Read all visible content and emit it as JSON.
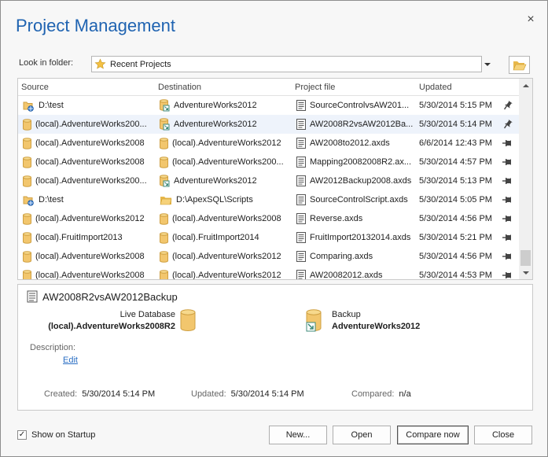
{
  "dialog": {
    "title": "Project Management",
    "close_glyph": "×"
  },
  "folder": {
    "label": "Look in folder:",
    "selected": "Recent Projects",
    "icon": "star-icon",
    "browse_icon": "open-folder-icon"
  },
  "list": {
    "columns": {
      "source": "Source",
      "destination": "Destination",
      "project_file": "Project file",
      "updated": "Updated"
    },
    "rows": [
      {
        "source": "D:\\test",
        "src_icon": "script-folder-icon",
        "destination": "AdventureWorks2012",
        "dst_icon": "backup-icon",
        "file": "SourceControlvsAW201...",
        "updated": "5/30/2014 5:15 PM",
        "pinned": true,
        "selected": false
      },
      {
        "source": "(local).AdventureWorks200...",
        "src_icon": "database-icon",
        "destination": "AdventureWorks2012",
        "dst_icon": "backup-icon",
        "file": "AW2008R2vsAW2012Ba...",
        "updated": "5/30/2014 5:14 PM",
        "pinned": true,
        "selected": true
      },
      {
        "source": "(local).AdventureWorks2008",
        "src_icon": "database-icon",
        "destination": "(local).AdventureWorks2012",
        "dst_icon": "database-icon",
        "file": "AW2008to2012.axds",
        "updated": "6/6/2014 12:43 PM",
        "pinned": false,
        "selected": false
      },
      {
        "source": "(local).AdventureWorks2008",
        "src_icon": "database-icon",
        "destination": "(local).AdventureWorks200...",
        "dst_icon": "database-icon",
        "file": "Mapping20082008R2.ax...",
        "updated": "5/30/2014 4:57 PM",
        "pinned": false,
        "selected": false
      },
      {
        "source": "(local).AdventureWorks200...",
        "src_icon": "database-icon",
        "destination": "AdventureWorks2012",
        "dst_icon": "backup-icon",
        "file": "AW2012Backup2008.axds",
        "updated": "5/30/2014 5:13 PM",
        "pinned": false,
        "selected": false
      },
      {
        "source": "D:\\test",
        "src_icon": "script-folder-icon",
        "destination": "D:\\ApexSQL\\Scripts",
        "dst_icon": "folder-icon",
        "file": "SourceControlScript.axds",
        "updated": "5/30/2014 5:05 PM",
        "pinned": false,
        "selected": false
      },
      {
        "source": "(local).AdventureWorks2012",
        "src_icon": "database-icon",
        "destination": "(local).AdventureWorks2008",
        "dst_icon": "database-icon",
        "file": "Reverse.axds",
        "updated": "5/30/2014 4:56 PM",
        "pinned": false,
        "selected": false
      },
      {
        "source": "(local).FruitImport2013",
        "src_icon": "database-icon",
        "destination": "(local).FruitImport2014",
        "dst_icon": "database-icon",
        "file": "FruitImport20132014.axds",
        "updated": "5/30/2014 5:21 PM",
        "pinned": false,
        "selected": false
      },
      {
        "source": "(local).AdventureWorks2008",
        "src_icon": "database-icon",
        "destination": "(local).AdventureWorks2012",
        "dst_icon": "database-icon",
        "file": "Comparing.axds",
        "updated": "5/30/2014 4:56 PM",
        "pinned": false,
        "selected": false
      },
      {
        "source": "(local).AdventureWorks2008",
        "src_icon": "database-icon",
        "destination": "(local).AdventureWorks2012",
        "dst_icon": "database-icon",
        "file": "AW20082012.axds",
        "updated": "5/30/2014 4:53 PM",
        "pinned": false,
        "selected": false
      }
    ]
  },
  "details": {
    "project_name": "AW2008R2vsAW2012Backup",
    "live_label": "Live Database",
    "live_db": "(local).AdventureWorks2008R2",
    "backup_label": "Backup",
    "backup_db": "AdventureWorks2012",
    "description_label": "Description:",
    "edit_link": "Edit",
    "created_label": "Created:",
    "created_value": "5/30/2014 5:14 PM",
    "updated_label": "Updated:",
    "updated_value": "5/30/2014 5:14 PM",
    "compared_label": "Compared:",
    "compared_value": "n/a"
  },
  "footer": {
    "show_on_startup_label": "Show on Startup",
    "show_on_startup_checked": true,
    "check_glyph": "✓",
    "buttons": {
      "new": "New...",
      "open": "Open",
      "compare": "Compare now",
      "close": "Close"
    }
  },
  "colors": {
    "title": "#1f63b1",
    "link": "#2b6fc4",
    "db_gold": "#f2c66d",
    "selected_row": "#eef3fb"
  }
}
